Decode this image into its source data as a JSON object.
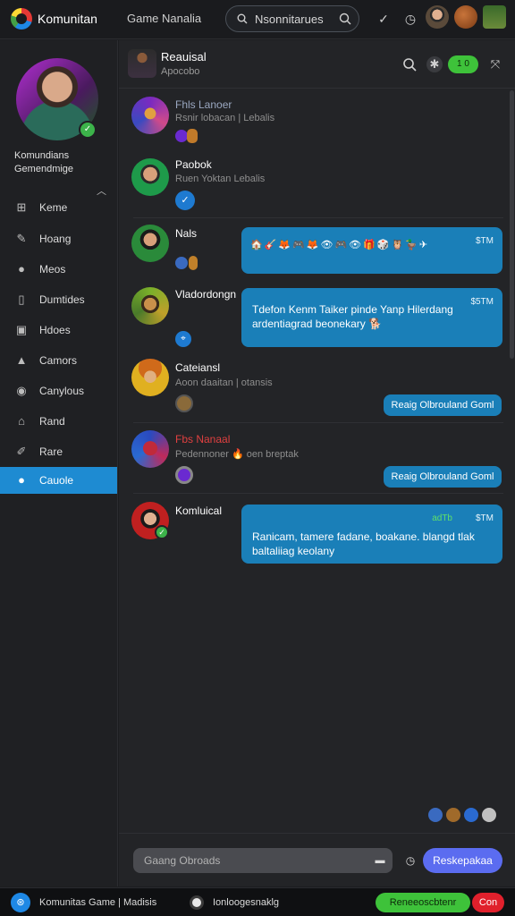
{
  "topbar": {
    "app_title": "Komunitan",
    "nav_title": "Game Nanalia",
    "search_placeholder": "Nsonnitarues",
    "icons": [
      "chevron-down-icon",
      "clock-icon",
      "user-avatar",
      "ball-avatar",
      "character-avatar"
    ]
  },
  "sidebar": {
    "profile_name_line1": "Komundians",
    "profile_name_line2": "Gemendmige",
    "items": [
      {
        "label": "Keme",
        "icon": "grid-icon"
      },
      {
        "label": "Hoang",
        "icon": "pencil-icon"
      },
      {
        "label": "Meos",
        "icon": "person-icon"
      },
      {
        "label": "Dumtides",
        "icon": "book-icon"
      },
      {
        "label": "Hdoes",
        "icon": "image-icon"
      },
      {
        "label": "Camors",
        "icon": "warning-icon"
      },
      {
        "label": "Canylous",
        "icon": "user-icon"
      },
      {
        "label": "Rand",
        "icon": "home-icon"
      },
      {
        "label": "Rare",
        "icon": "edit-icon"
      },
      {
        "label": "Cauole",
        "icon": "user-icon",
        "active": true
      }
    ]
  },
  "channel": {
    "title": "Reauisal",
    "subtitle": "Apocobo",
    "online_count": "1 0"
  },
  "messages": [
    {
      "name": "Fhls Lanoer",
      "sub": "Rsnir lobacan | Lebalis",
      "name_color": "#9aa7c0"
    },
    {
      "name": "Paobok",
      "sub": "Ruen Yoktan Lebalis"
    },
    {
      "name": "Nals",
      "price": "$TM",
      "bubble_emojis": "🏠🎸🦊🎮🦊👁🎮👁🎁🎲🦉🦆✈"
    },
    {
      "name": "Vladordongn",
      "price": "$5TM",
      "bubble_text": "Tdefon Kenm Taiker pinde Yanp Hilerdang ardentiagrad beonekary 🐕"
    },
    {
      "name": "Cateiansl",
      "sub": "Aoon daaitan | otansis",
      "reply": "Reaig Olbrouland Goml"
    },
    {
      "name": "Fbs Nanaal",
      "sub": "Pedennoner 🔥 oen breptak",
      "name_color": "#e04040",
      "reply": "Reaig Olbrouland Goml"
    },
    {
      "name": "Komluical",
      "price": "$TM",
      "tag": "adTb",
      "bubble_text": "Ranicam, tamere fadane, boakane. blangd tlak baltaliiag keolany"
    }
  ],
  "composer": {
    "placeholder": "Gaang Obroads",
    "send_label": "Reskepakaa"
  },
  "statusbar": {
    "left_text": "Komunitas Game | Madisis",
    "status_text": "Ionloogesnaklg",
    "green_button": "Reneeoscbtenr",
    "red_button": "Con"
  },
  "colors": {
    "accent": "#1a7fb8",
    "active_nav": "#1e8bd2",
    "online": "#3ec23a",
    "send": "#5b6cf0",
    "danger": "#e0202c"
  }
}
